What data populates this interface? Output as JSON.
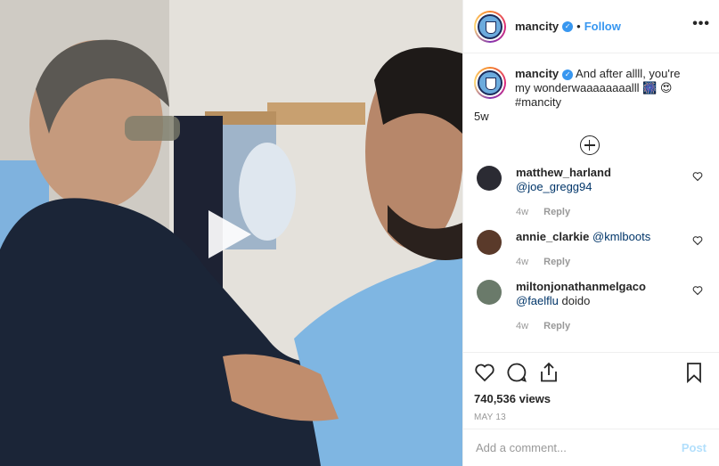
{
  "post": {
    "account": {
      "username": "mancity",
      "verified": true,
      "follow_label": "Follow",
      "separator": "•",
      "more_icon": "more-icon"
    },
    "caption": {
      "username": "mancity",
      "text": "And after allll, you're my wonderwaaaaaaaalll 🎆 😍 #mancity",
      "time": "5w"
    },
    "load_more_icon": "plus-circle-icon",
    "comments": [
      {
        "username": "matthew_harland",
        "mention": "@joe_gregg94",
        "text": "",
        "time": "4w",
        "reply_label": "Reply",
        "avatar_color": "#2b2b33"
      },
      {
        "username": "annie_clarkie",
        "mention": "@kmlboots",
        "text": "",
        "time": "4w",
        "reply_label": "Reply",
        "avatar_color": "#5a3a2a"
      },
      {
        "username": "miltonjonathanmelgaco",
        "mention": "@faelflu",
        "text": "doido",
        "time": "4w",
        "reply_label": "Reply",
        "avatar_color": "#6a7a6a"
      }
    ],
    "views": "740,536 views",
    "date": "MAY 13",
    "add_comment": {
      "placeholder": "Add a comment...",
      "post_label": "Post"
    },
    "colors": {
      "accent": "#3897f0",
      "mention": "#003569",
      "muted": "#999999",
      "post_disabled": "#b2dffc",
      "city_blue": "#6cabdd"
    }
  }
}
